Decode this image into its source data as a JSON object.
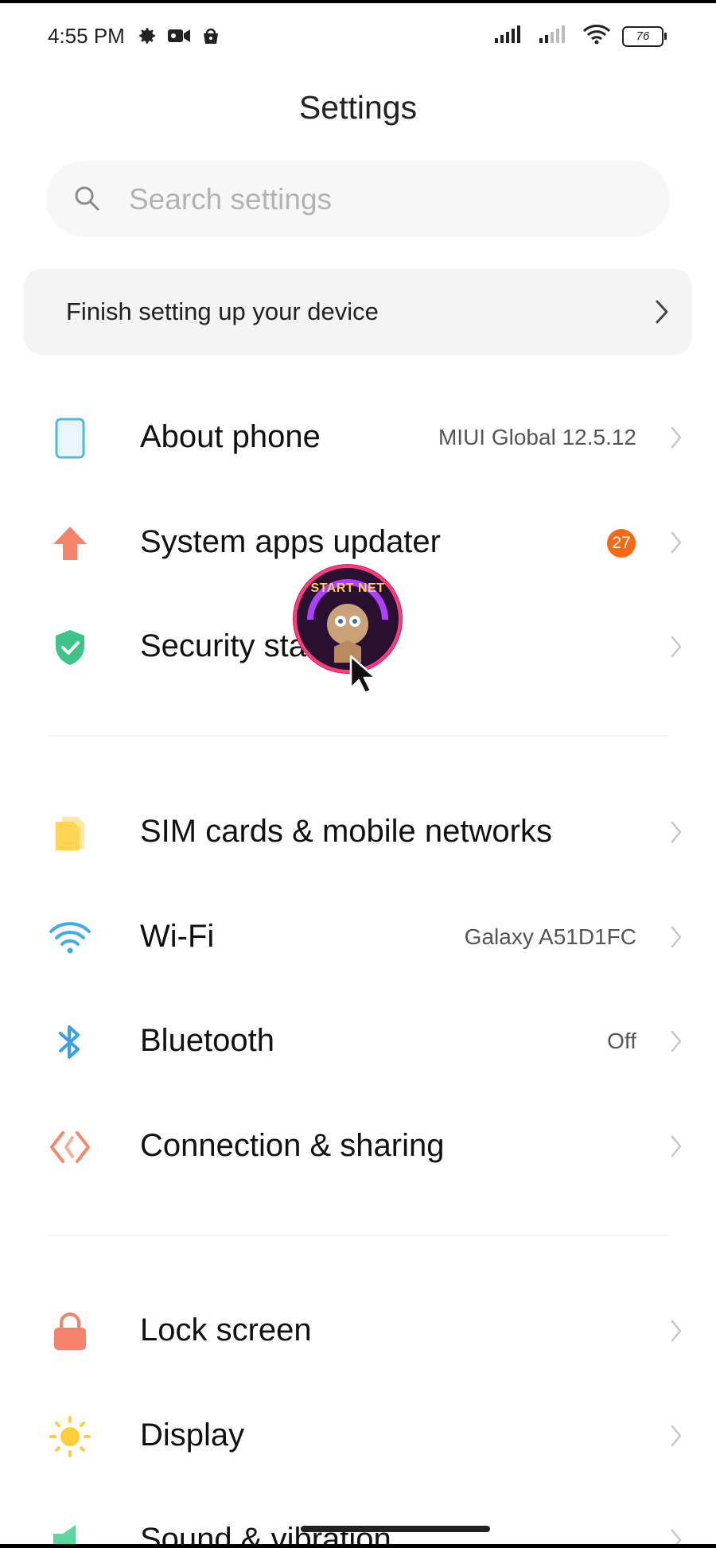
{
  "status_bar": {
    "time": "4:55 PM",
    "left_icons": [
      "gear-icon",
      "video-camera-icon",
      "shopping-bag-icon"
    ],
    "right_icons": [
      "signal-bars-icon",
      "signal-bars-icon",
      "wifi-icon",
      "battery-icon"
    ],
    "battery_level": "76"
  },
  "header": {
    "title": "Settings"
  },
  "search": {
    "placeholder": "Search settings"
  },
  "setup_banner": {
    "label": "Finish setting up your device"
  },
  "groups": [
    [
      {
        "label": "About phone",
        "value": "MIUI Global 12.5.12",
        "icon": "phone-outline-icon",
        "color": "#4fb9e6"
      },
      {
        "label": "System apps updater",
        "badge": "27",
        "icon": "arrow-up-icon",
        "color": "#f5826a"
      },
      {
        "label": "Security sta",
        "icon": "shield-check-icon",
        "color": "#3dc488"
      }
    ],
    [
      {
        "label": "SIM cards & mobile networks",
        "icon": "sim-card-icon",
        "color": "#ffd452"
      },
      {
        "label": "Wi-Fi",
        "value": "Galaxy A51D1FC",
        "icon": "wifi-icon",
        "color": "#44a9ea"
      },
      {
        "label": "Bluetooth",
        "value": "Off",
        "icon": "bluetooth-icon",
        "color": "#3a9fe4"
      },
      {
        "label": "Connection & sharing",
        "icon": "connection-sharing-icon",
        "color": "#f08a6a"
      }
    ],
    [
      {
        "label": "Lock screen",
        "icon": "lock-icon",
        "color": "#f5826a"
      },
      {
        "label": "Display",
        "icon": "sun-icon",
        "color": "#ffcf3a"
      },
      {
        "label": "Sound & vibration",
        "icon": "speaker-icon",
        "color": "#5fd6a0"
      }
    ]
  ],
  "overlay": {
    "logo_text": "START NET"
  },
  "colors": {
    "badge": "#f56a12",
    "chevron": "#c7c7c7",
    "background": "#ffffff"
  }
}
